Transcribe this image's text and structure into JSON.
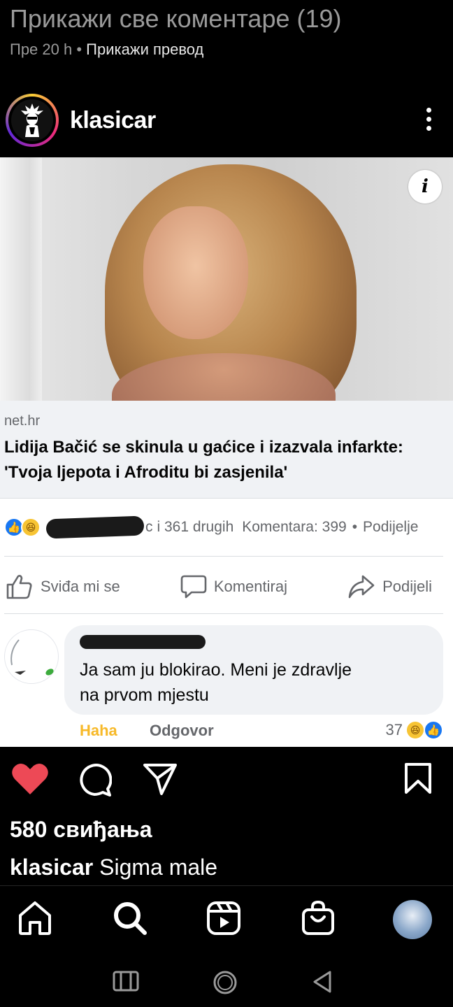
{
  "comments_link": {
    "view_all": "Прикажи све коментаре (19)",
    "time": "Пре 20 h",
    "separator": "•",
    "translate": "Прикажи превод"
  },
  "post": {
    "username": "klasicar",
    "more_icon": "more-vertical-icon"
  },
  "shared_fb_post": {
    "domain": "net.hr",
    "headline_line1": "Lidija Bačić se skinula u gaćice i izazvala infarkte:",
    "headline_line2": "'Tvoja ljepota i Afroditu bi zasjenila'",
    "reactions": {
      "redacted_suffix": "c",
      "others": "i 361 drugih",
      "comments": "Komentara: 399",
      "separator": "•",
      "shares": "Podijelje"
    },
    "actions": {
      "like": "Sviđa mi se",
      "comment": "Komentiraj",
      "share": "Podijeli"
    },
    "comment": {
      "text_line1": "Ja sam ju blokirao. Meni je zdravlje",
      "text_line2": "na prvom mjestu",
      "haha": "Haha",
      "reply": "Odgovor",
      "count": "37"
    }
  },
  "ig": {
    "likes": "580 свиђања",
    "caption_user": "klasicar",
    "caption_text": " Sigma male"
  },
  "colors": {
    "heart": "#ed4956",
    "fb_blue": "#1877f2",
    "haha_yellow": "#f7b928"
  }
}
